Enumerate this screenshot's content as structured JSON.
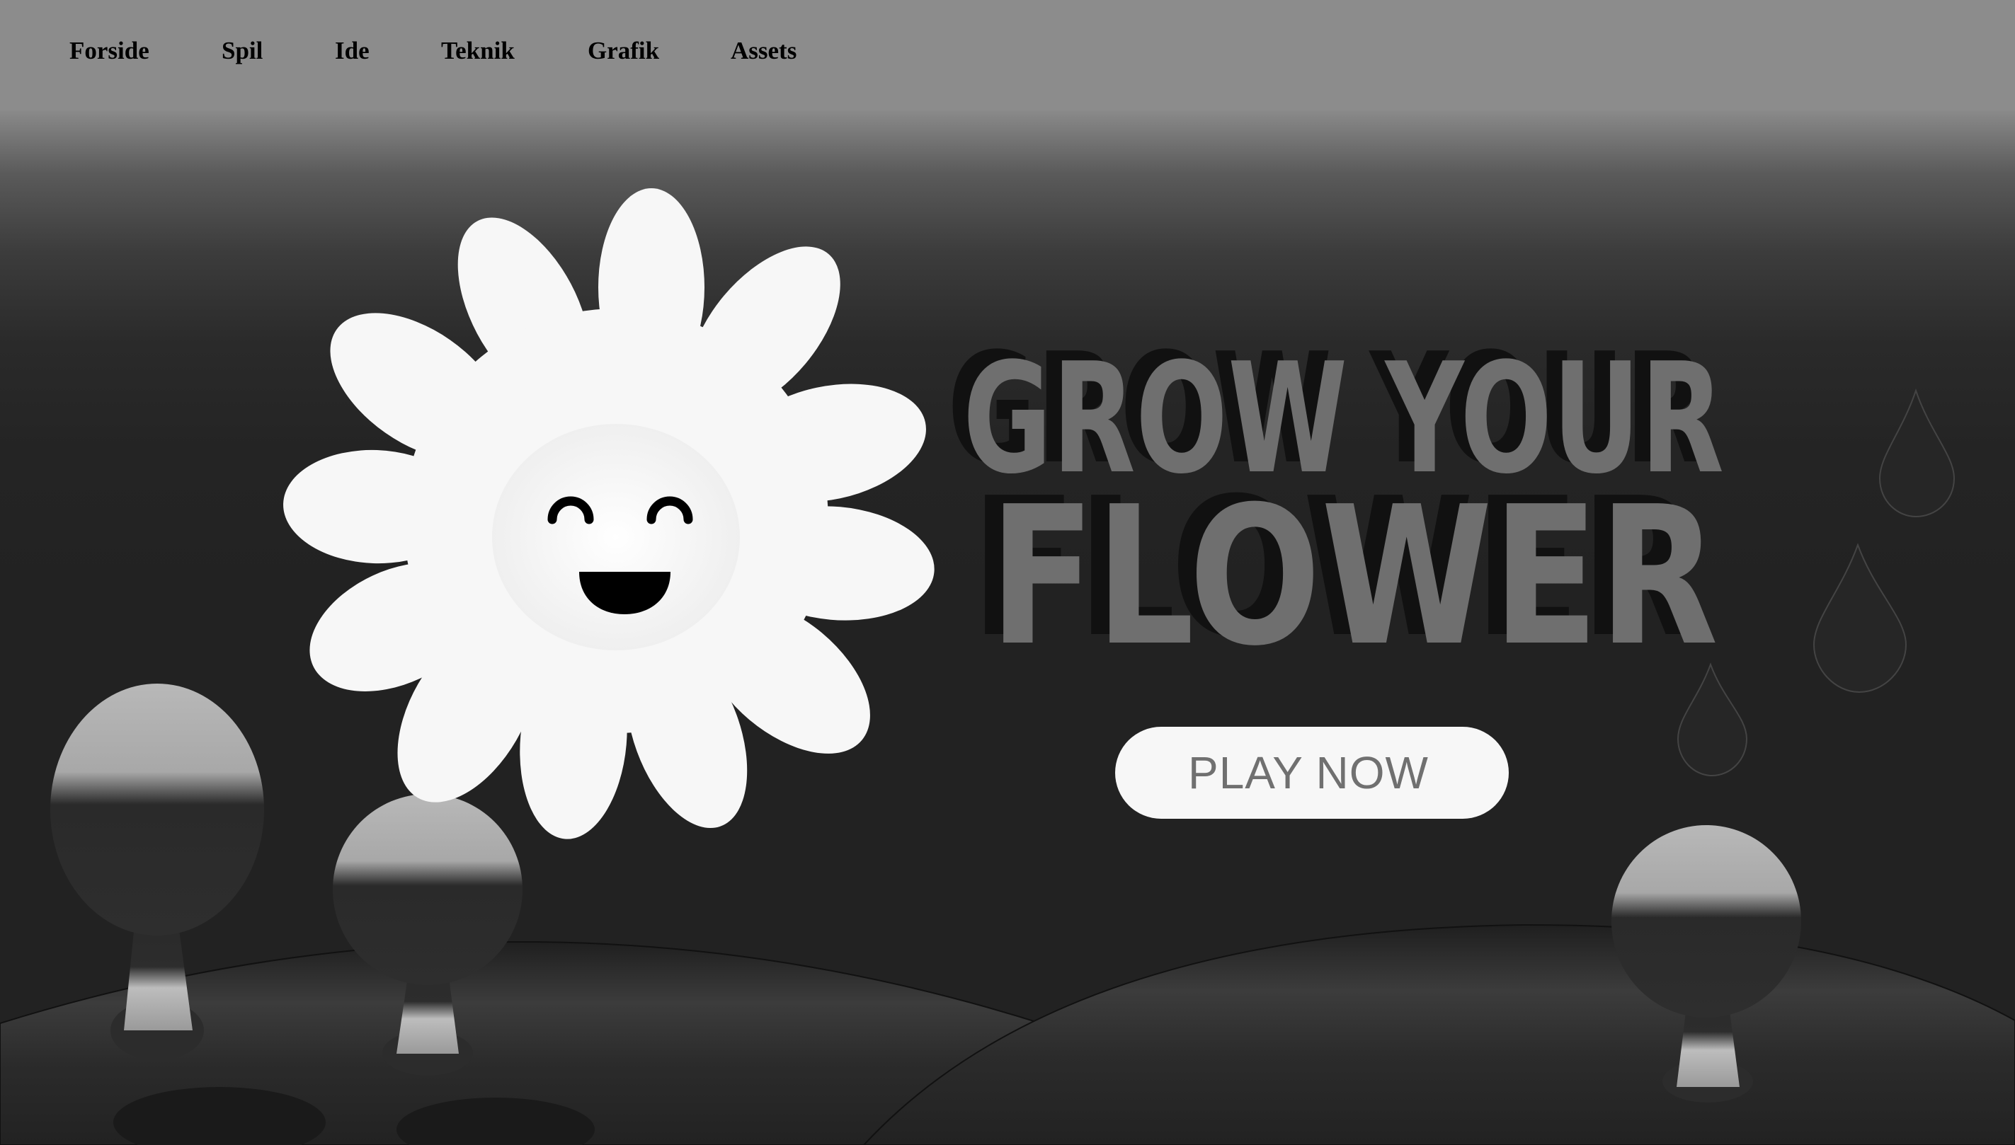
{
  "nav": {
    "items": [
      {
        "label": "Forside"
      },
      {
        "label": "Spil"
      },
      {
        "label": "Ide"
      },
      {
        "label": "Teknik"
      },
      {
        "label": "Grafik"
      },
      {
        "label": "Assets"
      }
    ]
  },
  "hero": {
    "title_line1": "GROW YOUR",
    "title_line2": "FLOWER",
    "play_label": "PLAY NOW"
  },
  "icons": {
    "flower": "smiling-daisy-icon",
    "raindrop": "raindrop-icon",
    "tree": "round-tree-icon"
  },
  "colors": {
    "nav_bg": "#8c8c8c",
    "page_bg": "#222222",
    "title_fill": "#6f6f6f",
    "button_bg": "#f7f7f7",
    "button_text": "#707070"
  }
}
